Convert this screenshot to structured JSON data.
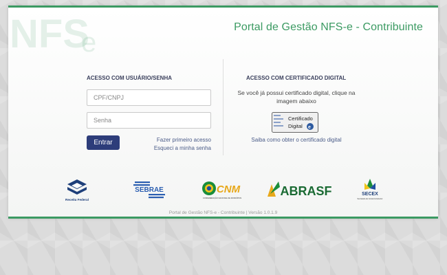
{
  "header": {
    "logo_text": "NFS",
    "logo_suffix": "e",
    "title": "Portal de Gestão NFS-e - Contribuinte"
  },
  "login": {
    "title": "ACESSO COM USUÁRIO/SENHA",
    "cpf_placeholder": "CPF/CNPJ",
    "cpf_value": "",
    "senha_placeholder": "Senha",
    "senha_value": "",
    "enter_label": "Entrar",
    "first_access": "Fazer primeiro acesso",
    "forgot_password": "Esqueci a minha senha"
  },
  "certificate": {
    "title": "ACESSO COM CERTIFICADO DIGITAL",
    "text": "Se você já possui certificado digital, clique na imagem abaixo",
    "badge_line1": "Certificado",
    "badge_line2": "Digital",
    "link": "Saiba como obter o certificado digital"
  },
  "partners": {
    "receita_label": "Receita Federal",
    "sebrae_label": "SEBRAE",
    "cnm_label": "CNM",
    "cnm_sub": "CONFEDERAÇÃO NACIONAL DE MUNICÍPIOS",
    "abrasf_label": "ABRASF",
    "secex_label": "SECEX",
    "secex_sub": "Secretaria de Comércio Exterior"
  },
  "footer": {
    "text": "Portal de Gestão NFS-e - Contribuinte | Versão 1.0.1.9"
  },
  "colors": {
    "brand_green": "#3b9a62",
    "navy": "#2d3d7a",
    "link": "#4a5b88"
  }
}
